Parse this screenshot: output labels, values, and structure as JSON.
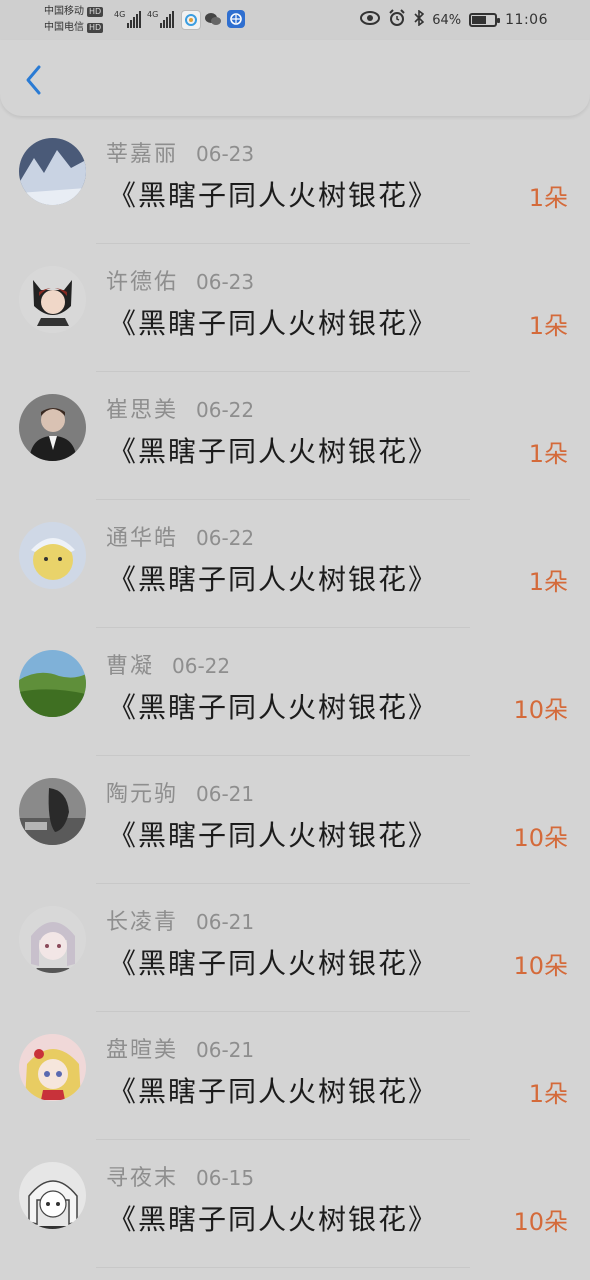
{
  "status_bar": {
    "carrier_1": "中国移动",
    "carrier_2": "中国电信",
    "hd_1": "HD",
    "hd_2": "HD",
    "net_1": "4G",
    "net_2": "4G",
    "battery_percent_text": "64%",
    "battery_level": 0.64,
    "time": "11:06"
  },
  "header": {
    "back_icon": "chevron-left-icon",
    "accent_color": "#2a7bd4"
  },
  "list": {
    "items": [
      {
        "name": "莘嘉丽",
        "date": "06-23",
        "title": "《黑瞎子同人火树银花》",
        "count": "1朵"
      },
      {
        "name": "许德佑",
        "date": "06-23",
        "title": "《黑瞎子同人火树银花》",
        "count": "1朵"
      },
      {
        "name": "崔思美",
        "date": "06-22",
        "title": "《黑瞎子同人火树银花》",
        "count": "1朵"
      },
      {
        "name": "通华皓",
        "date": "06-22",
        "title": "《黑瞎子同人火树银花》",
        "count": "1朵"
      },
      {
        "name": "曹凝",
        "date": "06-22",
        "title": "《黑瞎子同人火树银花》",
        "count": "10朵"
      },
      {
        "name": "陶元驹",
        "date": "06-21",
        "title": "《黑瞎子同人火树银花》",
        "count": "10朵"
      },
      {
        "name": "长凌青",
        "date": "06-21",
        "title": "《黑瞎子同人火树银花》",
        "count": "10朵"
      },
      {
        "name": "盘暄美",
        "date": "06-21",
        "title": "《黑瞎子同人火树银花》",
        "count": "1朵"
      },
      {
        "name": "寻夜末",
        "date": "06-15",
        "title": "《黑瞎子同人火树银花》",
        "count": "10朵"
      }
    ]
  },
  "colors": {
    "count_color": "#d46a3a",
    "name_color": "#8e8e8e",
    "background": "#d4d4d4"
  }
}
